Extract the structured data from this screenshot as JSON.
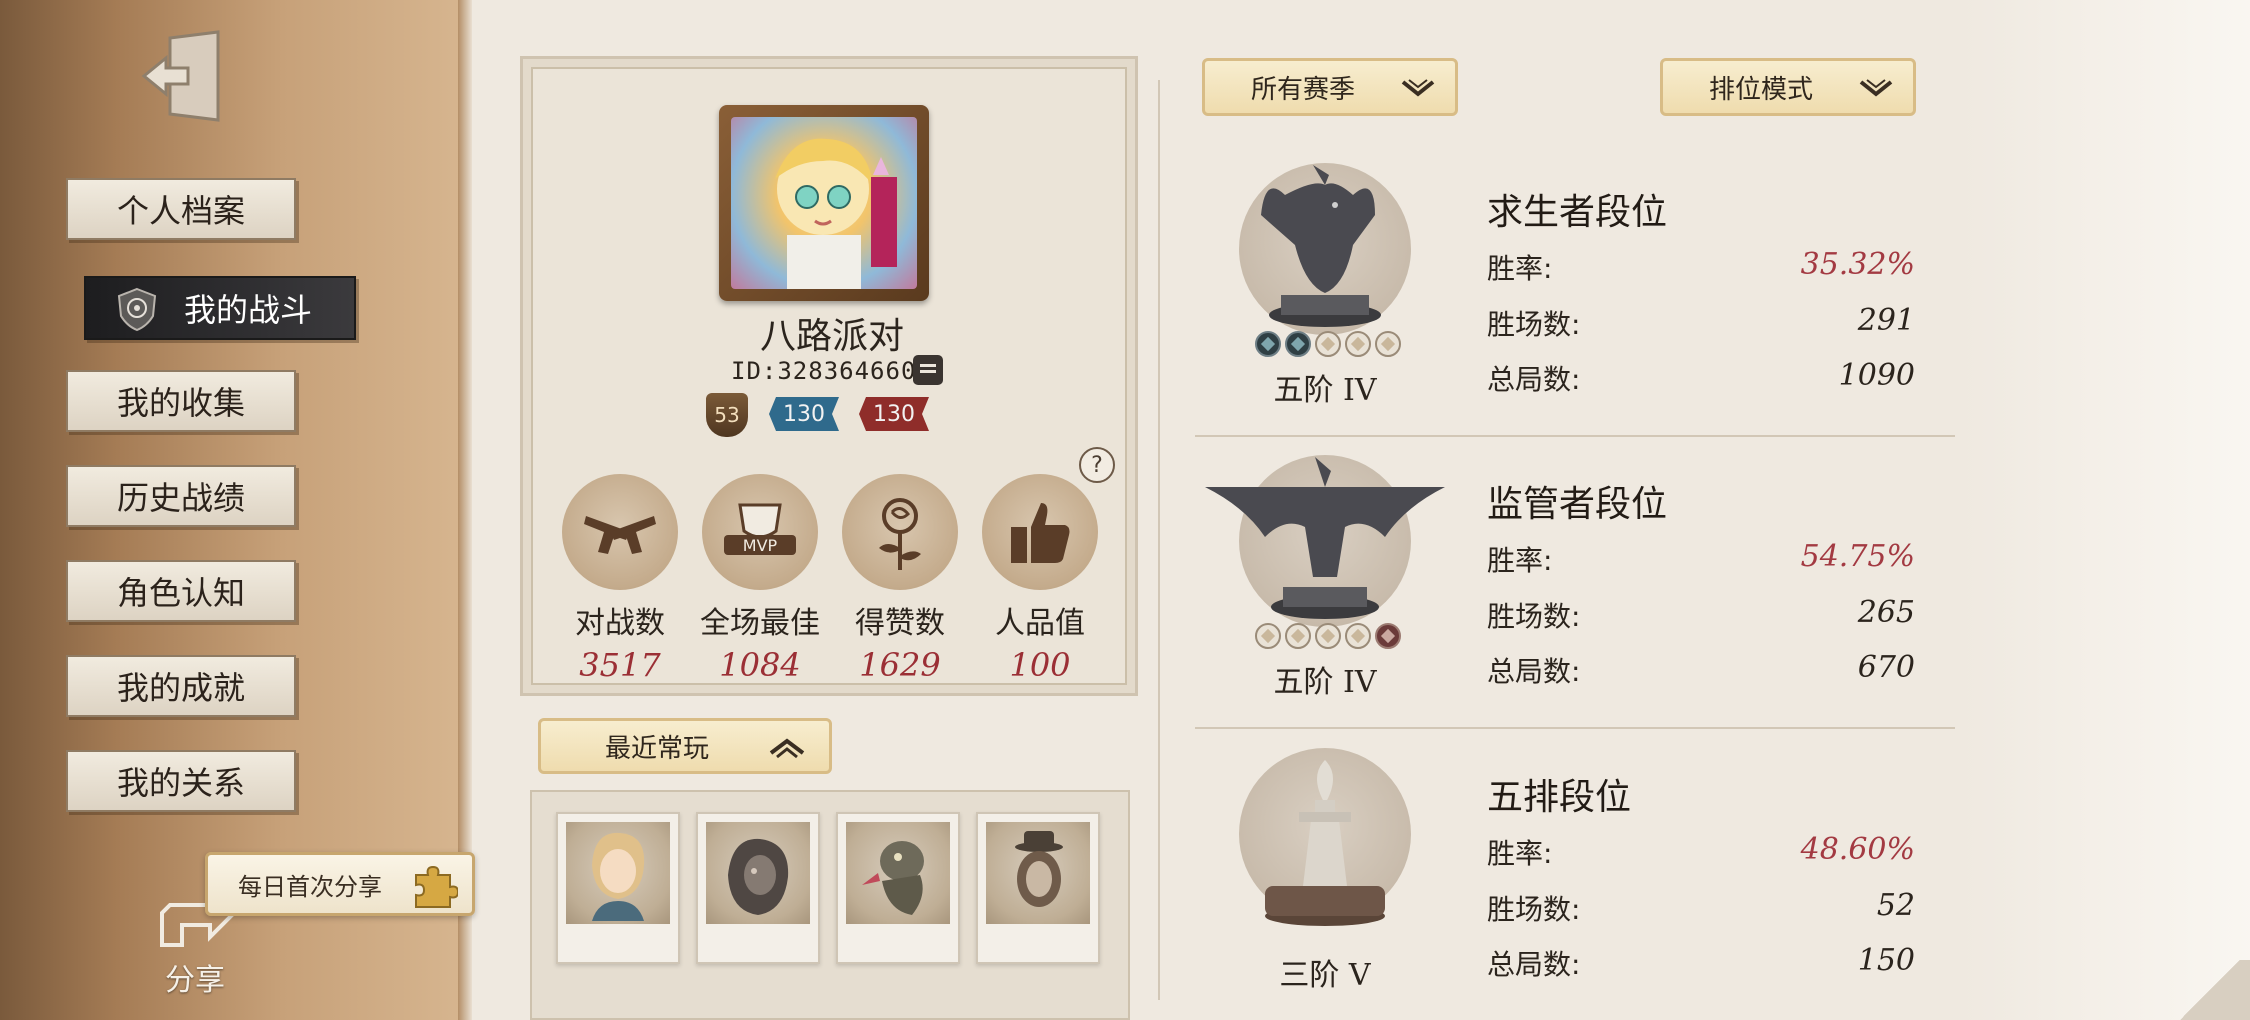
{
  "sidebar": {
    "items": [
      {
        "label": "个人档案"
      },
      {
        "label": "我的战斗"
      },
      {
        "label": "我的收集"
      },
      {
        "label": "历史战绩"
      },
      {
        "label": "角色认知"
      },
      {
        "label": "我的成就"
      },
      {
        "label": "我的关系"
      }
    ],
    "active_index": 1,
    "share_tip": "每日首次分享",
    "share_label": "分享"
  },
  "profile": {
    "nickname": "八路派对",
    "id_text": "ID:328364660",
    "level": "53",
    "rank_blue": "130",
    "rank_red": "130",
    "help_glyph": "?",
    "stats": [
      {
        "label": "对战数",
        "value": "3517",
        "icon": "dueling-pistols-icon"
      },
      {
        "label": "全场最佳",
        "value": "1084",
        "icon": "mvp-trophy-icon"
      },
      {
        "label": "得赞数",
        "value": "1629",
        "icon": "rose-icon"
      },
      {
        "label": "人品值",
        "value": "100",
        "icon": "thumbs-up-icon"
      }
    ]
  },
  "recent": {
    "label": "最近常玩",
    "characters": [
      {
        "name": "character-portrait-1"
      },
      {
        "name": "character-portrait-2"
      },
      {
        "name": "character-portrait-3"
      },
      {
        "name": "character-portrait-4"
      }
    ]
  },
  "filters": {
    "season": "所有赛季",
    "mode": "排位模式"
  },
  "ranks": [
    {
      "title": "求生者段位",
      "tier": "五阶 IV",
      "stars_filled": 2,
      "star_color": "teal",
      "win_rate_label": "胜率:",
      "win_rate": "35.32%",
      "wins_label": "胜场数:",
      "wins": "291",
      "total_label": "总局数:",
      "total": "1090"
    },
    {
      "title": "监管者段位",
      "tier": "五阶 IV",
      "stars_filled": 1,
      "star_color": "red",
      "win_rate_label": "胜率:",
      "win_rate": "54.75%",
      "wins_label": "胜场数:",
      "wins": "265",
      "total_label": "总局数:",
      "total": "670"
    },
    {
      "title": "五排段位",
      "tier": "三阶 V",
      "stars_filled": 0,
      "star_color": "none",
      "win_rate_label": "胜率:",
      "win_rate": "48.60%",
      "wins_label": "胜场数:",
      "wins": "52",
      "total_label": "总局数:",
      "total": "150"
    }
  ],
  "colors": {
    "accent_red": "#a33a42",
    "sidebar_brown": "#a57c55",
    "paper": "#efe9e0"
  }
}
